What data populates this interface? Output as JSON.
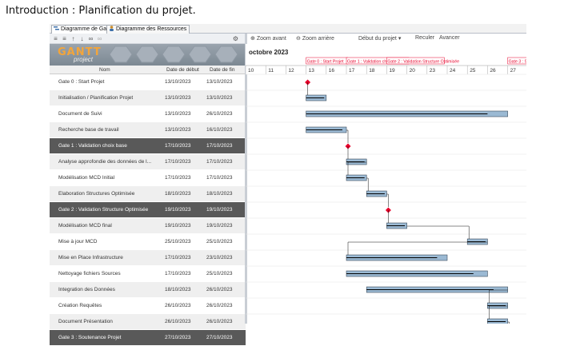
{
  "slide_title": "Introduction : Planification du projet.",
  "tabs": [
    {
      "label": "Diagramme de Gantt"
    },
    {
      "label": "Diagramme des Ressources"
    }
  ],
  "logo": {
    "text": "GANTT",
    "sub": "project"
  },
  "toolbar": {
    "zoom_in": "Zoom avant",
    "zoom_out": "Zoom arrière",
    "project_start": "Début du projet",
    "back": "Reculer",
    "forward": "Avancer"
  },
  "columns": {
    "name": "Nom",
    "start": "Date de début",
    "end": "Date de fin"
  },
  "timeline": {
    "month": "octobre 2023",
    "days": [
      "10",
      "11",
      "12",
      "13",
      "16",
      "17",
      "18",
      "19",
      "20",
      "23",
      "24",
      "25",
      "26",
      "27"
    ]
  },
  "milestone_labels": [
    "Gate 0 : Start Projet",
    "Gate 1 : Validation choix base",
    "Gate 2 : Validation Structure Optimisée",
    "Gate 3 : Sout"
  ],
  "tasks": [
    {
      "name": "Gate 0 : Start Projet",
      "start": "13/10/2023",
      "end": "13/10/2023",
      "style": "normal"
    },
    {
      "name": "Initialisation / Planification Projet",
      "start": "13/10/2023",
      "end": "13/10/2023",
      "style": "alt"
    },
    {
      "name": "Document de Suivi",
      "start": "13/10/2023",
      "end": "26/10/2023",
      "style": "normal"
    },
    {
      "name": "Recherche base de travail",
      "start": "13/10/2023",
      "end": "16/10/2023",
      "style": "alt"
    },
    {
      "name": "Gate 1 : Validation choix base",
      "start": "17/10/2023",
      "end": "17/10/2023",
      "style": "gate"
    },
    {
      "name": "Analyse approfondie des données de l...",
      "start": "17/10/2023",
      "end": "17/10/2023",
      "style": "alt"
    },
    {
      "name": "Modélisation MCD Initial",
      "start": "17/10/2023",
      "end": "17/10/2023",
      "style": "normal"
    },
    {
      "name": "Elaboration Structures Optimisée",
      "start": "18/10/2023",
      "end": "18/10/2023",
      "style": "alt"
    },
    {
      "name": "Gate 2 : Validation Structure Optimisée",
      "start": "19/10/2023",
      "end": "19/10/2023",
      "style": "gate"
    },
    {
      "name": "Modélisation MCD final",
      "start": "19/10/2023",
      "end": "19/10/2023",
      "style": "alt"
    },
    {
      "name": "Mise à jour MCD",
      "start": "25/10/2023",
      "end": "25/10/2023",
      "style": "normal"
    },
    {
      "name": "Mise en Place Infrastructure",
      "start": "17/10/2023",
      "end": "23/10/2023",
      "style": "alt"
    },
    {
      "name": "Nettoyage fichiers Sources",
      "start": "17/10/2023",
      "end": "25/10/2023",
      "style": "normal"
    },
    {
      "name": "Integration des Données",
      "start": "18/10/2023",
      "end": "26/10/2023",
      "style": "alt"
    },
    {
      "name": "Création Requêtes",
      "start": "26/10/2023",
      "end": "26/10/2023",
      "style": "normal"
    },
    {
      "name": "Document Présentation",
      "start": "26/10/2023",
      "end": "26/10/2023",
      "style": "alt"
    },
    {
      "name": "Gate 3 : Soutenance Projet",
      "start": "27/10/2023",
      "end": "27/10/2023",
      "style": "gate"
    }
  ],
  "colors": {
    "bar": "#9bb9d3",
    "bar_border": "#3a4a5a",
    "progress": "#000000",
    "milestone": "#e8002a",
    "gate_row": "#595959"
  }
}
